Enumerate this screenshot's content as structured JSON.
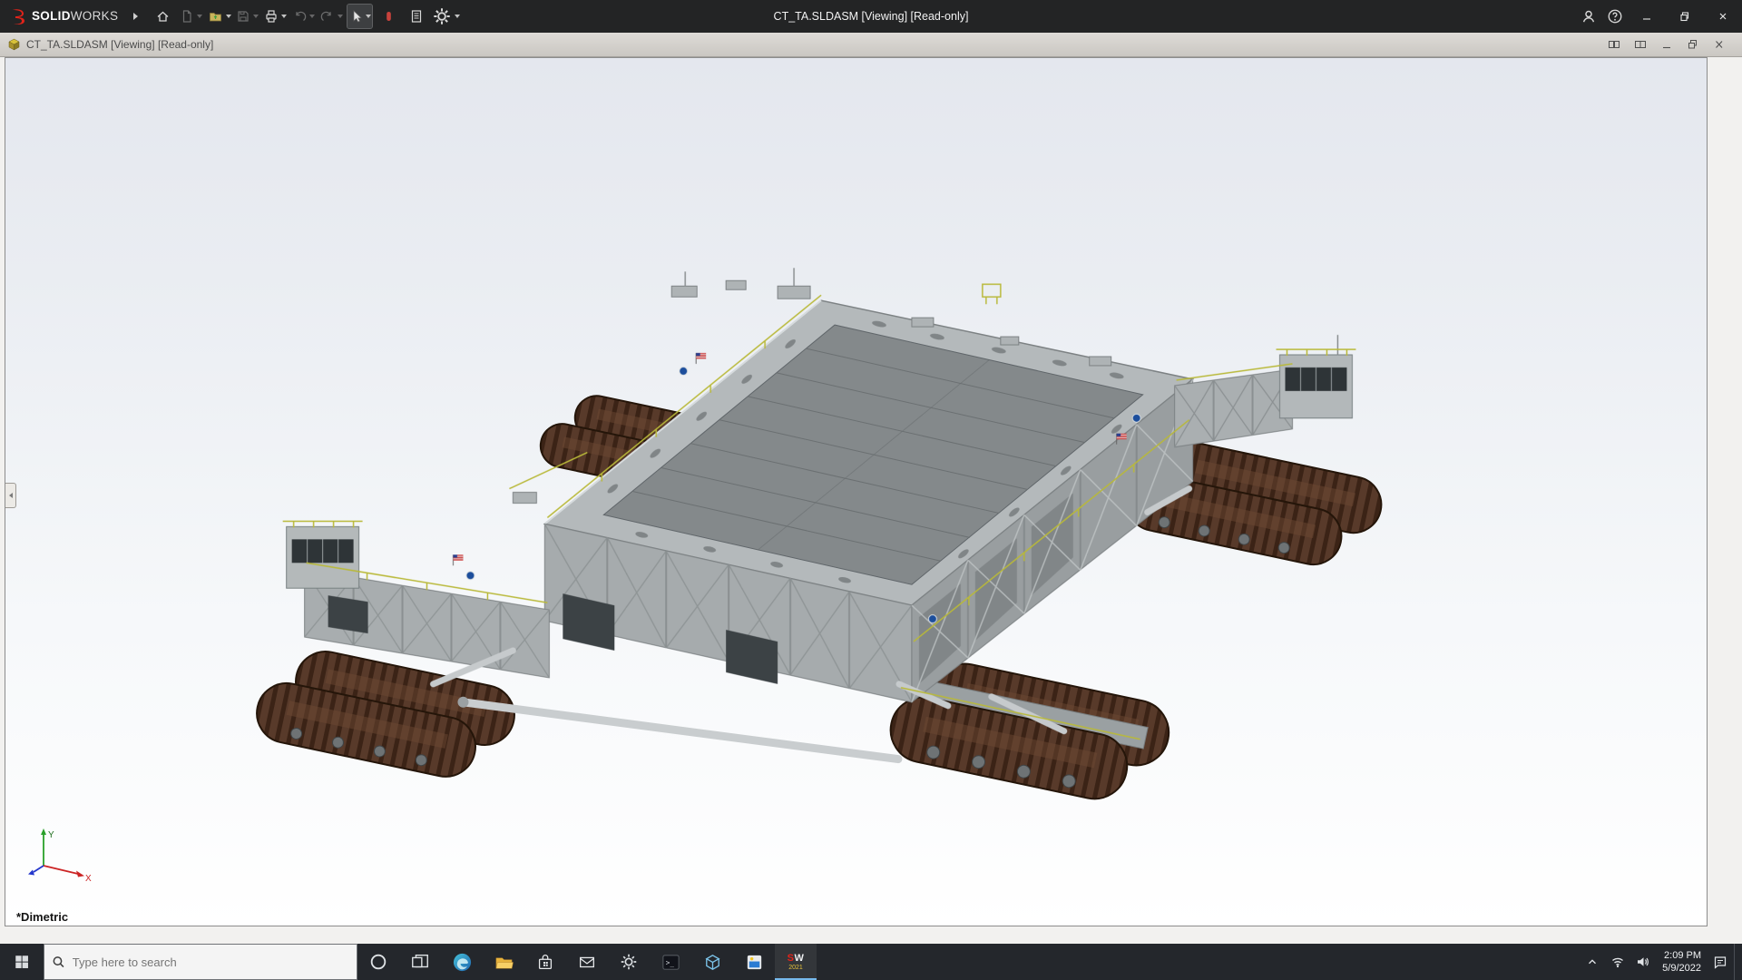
{
  "app": {
    "title": "CT_TA.SLDASM [Viewing] [Read-only]",
    "brand_bold": "SOLID",
    "brand_light": "WORKS",
    "toolbar_icons": [
      "home",
      "new-document",
      "open",
      "save",
      "print",
      "undo",
      "redo",
      "select-tool",
      "3dexperience",
      "document-properties",
      "options-gear"
    ],
    "window_controls": [
      "account",
      "help",
      "minimize",
      "restore",
      "close"
    ]
  },
  "doc": {
    "title": "CT_TA.SLDASM [Viewing] [Read-only]",
    "controls": [
      "tile-windows",
      "split-pane",
      "minimize",
      "restore",
      "close"
    ]
  },
  "viewport": {
    "view_label": "*Dimetric",
    "triad_x": "X",
    "triad_y": "Y"
  },
  "taskbar": {
    "search_placeholder": "Type here to search",
    "sw_logo": "SW",
    "sw_badge": "2021",
    "clock": {
      "time": "2:09 PM",
      "date": "5/9/2022"
    },
    "pinned_icons": [
      "start",
      "search",
      "cortana",
      "task-view",
      "edge",
      "file-explorer",
      "store",
      "mail",
      "settings",
      "terminal",
      "edrawings",
      "photos",
      "solidworks-2021"
    ],
    "tray_icons": [
      "hidden-icons-chevron",
      "network",
      "volume",
      "clock",
      "action-center",
      "show-desktop"
    ]
  },
  "colors": {
    "brand_red": "#e2231a",
    "titlebar_bg": "#232425",
    "taskbar_bg": "#24272c",
    "steel_gray": "#b4b9bb",
    "deck_gray": "#84898b",
    "track_brown": "#583a2a",
    "safety_yellow": "#b9b93a",
    "nasa_blue": "#1c4e9c"
  }
}
